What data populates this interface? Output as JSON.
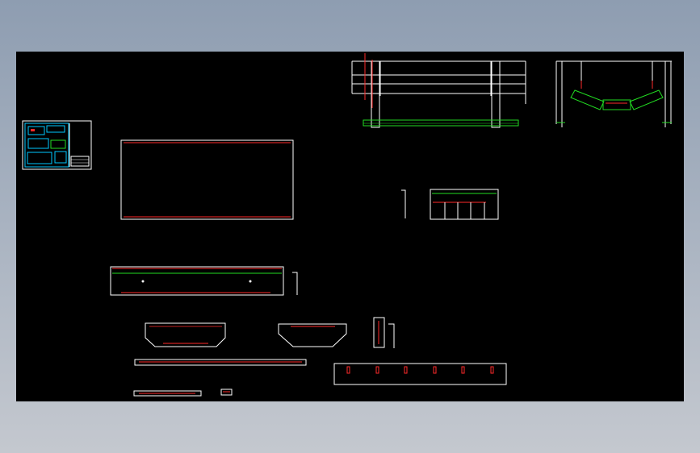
{
  "viewer": {
    "background_top": "#8e9db1",
    "background_bottom": "#c4c8cf",
    "canvas_color": "#000000"
  },
  "drawing": {
    "line_color": "#ffffff",
    "accent_red": "#ff2a2a",
    "accent_green": "#22dd22",
    "accent_cyan": "#00c8ff"
  }
}
